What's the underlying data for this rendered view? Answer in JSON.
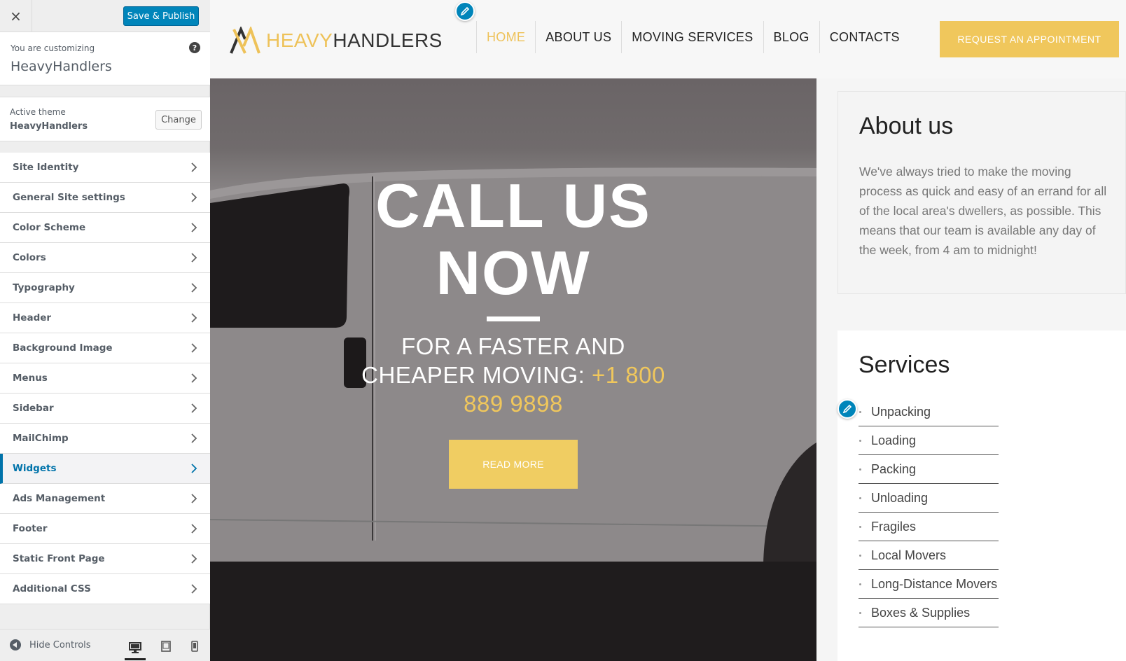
{
  "customizer": {
    "close_label": "×",
    "save_label": "Save & Publish",
    "customizing_label": "You are customizing",
    "site_name": "HeavyHandlers",
    "active_theme_label": "Active theme",
    "active_theme_name": "HeavyHandlers",
    "change_label": "Change",
    "menu": [
      {
        "label": "Site Identity"
      },
      {
        "label": "General Site settings"
      },
      {
        "label": "Color Scheme"
      },
      {
        "label": "Colors"
      },
      {
        "label": "Typography"
      },
      {
        "label": "Header"
      },
      {
        "label": "Background Image"
      },
      {
        "label": "Menus"
      },
      {
        "label": "Sidebar"
      },
      {
        "label": "MailChimp"
      },
      {
        "label": "Widgets",
        "active": true
      },
      {
        "label": "Ads Management"
      },
      {
        "label": "Footer"
      },
      {
        "label": "Static Front Page"
      },
      {
        "label": "Additional CSS"
      }
    ],
    "hide_controls_label": "Hide Controls",
    "devices": [
      "desktop-icon",
      "tablet-icon",
      "mobile-icon"
    ],
    "accent_color": "#0085ba"
  },
  "site": {
    "logo_heavy": "HEAVY",
    "logo_handlers": "HANDLERS",
    "nav": [
      {
        "label": "HOME",
        "active": true
      },
      {
        "label": "ABOUT US"
      },
      {
        "label": "MOVING SERVICES"
      },
      {
        "label": "BLOG"
      },
      {
        "label": "CONTACTS"
      }
    ],
    "cta_label": "REQUEST AN APPOINTMENT",
    "brand_color": "#f0c75c",
    "hero": {
      "title_line1": "CALL US",
      "title_line2": "NOW",
      "sub_line1": "FOR A FASTER AND",
      "sub_line2": "CHEAPER MOVING:",
      "phone_part1": "+1 800",
      "phone_part2": "889 9898",
      "button_label": "READ MORE"
    },
    "about": {
      "title": "About us",
      "text": "We've always tried to make the moving process as quick and easy of an errand for all of the local area's dwellers, as possible. This means that our team is available any day of the week, from 4 am to midnight!"
    },
    "services": {
      "title": "Services",
      "items": [
        "Unpacking",
        "Loading",
        "Packing",
        "Unloading",
        "Fragiles",
        "Local Movers",
        "Long-Distance Movers",
        "Boxes & Supplies"
      ]
    }
  }
}
